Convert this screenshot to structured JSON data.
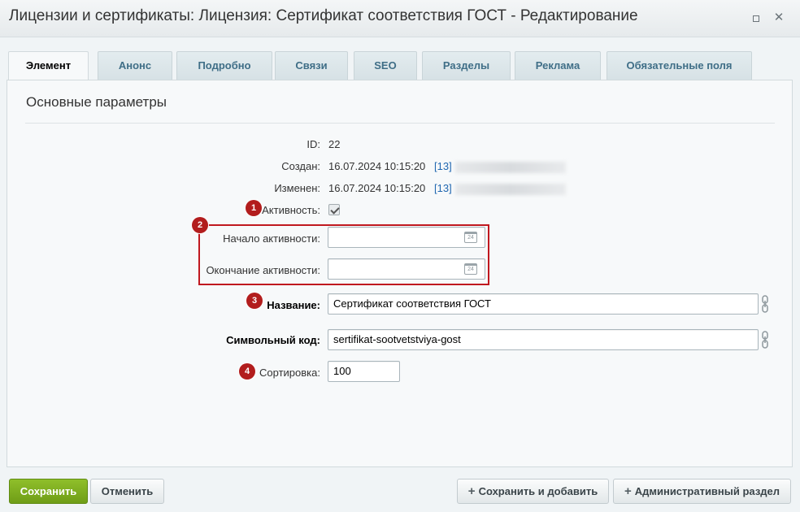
{
  "window": {
    "title": "Лицензии и сертификаты: Лицензия: Сертификат соответствия ГОСТ - Редактирование",
    "maximize_icon": "maximize-icon",
    "close_glyph": "✕"
  },
  "tabs": [
    {
      "label": "Элемент",
      "active": true
    },
    {
      "label": "Анонс"
    },
    {
      "label": "Подробно"
    },
    {
      "label": "Связи"
    },
    {
      "label": "SEO"
    },
    {
      "label": "Разделы"
    },
    {
      "label": "Реклама"
    },
    {
      "label": "Обязательные поля"
    }
  ],
  "section": {
    "title": "Основные параметры"
  },
  "fields": {
    "id": {
      "label": "ID:",
      "value": "22"
    },
    "created": {
      "label": "Создан:",
      "value": "16.07.2024 10:15:20",
      "user_link": "[13]"
    },
    "modified": {
      "label": "Изменен:",
      "value": "16.07.2024 10:15:20",
      "user_link": "[13]"
    },
    "active": {
      "label": "Активность:",
      "checked": true
    },
    "active_from": {
      "label": "Начало активности:",
      "value": ""
    },
    "active_to": {
      "label": "Окончание активности:",
      "value": ""
    },
    "name": {
      "label": "Название:",
      "value": "Сертификат соответствия ГОСТ"
    },
    "code": {
      "label": "Символьный код:",
      "value": "sertifikat-sootvetstviya-gost"
    },
    "sort": {
      "label": "Сортировка:",
      "value": "100"
    },
    "calendar_icon_text": "24"
  },
  "annotations": {
    "badge1": "1",
    "badge2": "2",
    "badge3": "3",
    "badge4": "4",
    "color": "#b21d1d"
  },
  "buttons": {
    "save": "Сохранить",
    "cancel": "Отменить",
    "save_and_add": "Сохранить и добавить",
    "admin_section": "Административный раздел",
    "plus_glyph": "+"
  },
  "colors": {
    "save_button": "#7cad1f",
    "tab_text": "#3f6e87",
    "link": "#2067b0",
    "highlight": "#c0181f"
  }
}
